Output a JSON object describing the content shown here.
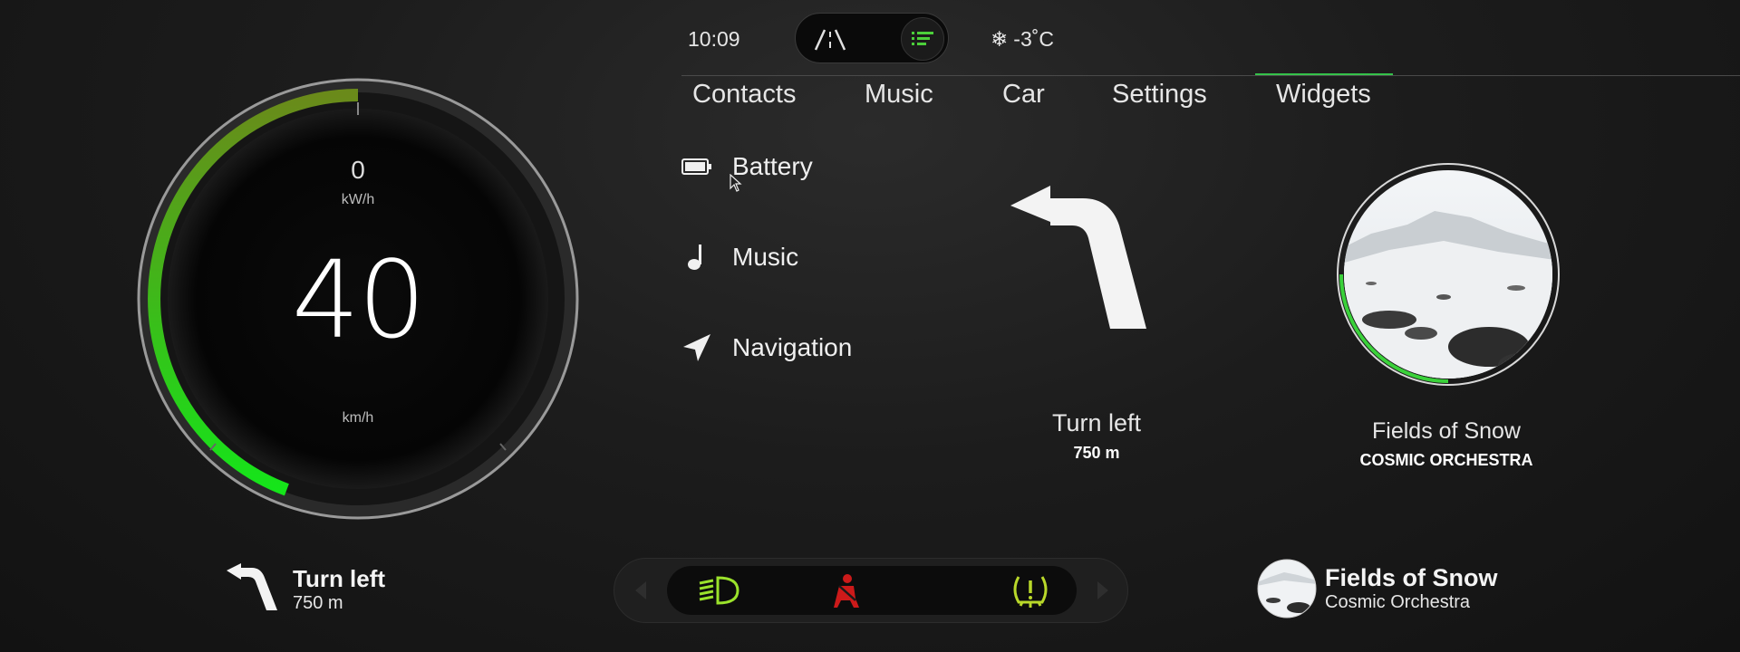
{
  "status": {
    "time": "10:09",
    "temperature": "-3˚C",
    "temp_icon": "snowflake-icon",
    "mode_icons": [
      "road-icon",
      "list-icon"
    ]
  },
  "tabs": [
    {
      "label": "Contacts",
      "active": false
    },
    {
      "label": "Music",
      "active": false
    },
    {
      "label": "Car",
      "active": false
    },
    {
      "label": "Settings",
      "active": false
    },
    {
      "label": "Widgets",
      "active": true
    }
  ],
  "gauge": {
    "power_value": "0",
    "power_unit": "kW/h",
    "speed_value": "40",
    "speed_unit": "km/h",
    "progress_fraction": 0.4,
    "accent_start": "#6b8a1e",
    "accent_end": "#1ee21e"
  },
  "widgets": [
    {
      "label": "Battery",
      "icon": "battery-icon"
    },
    {
      "label": "Music",
      "icon": "music-note-icon"
    },
    {
      "label": "Navigation",
      "icon": "navigation-arrow-icon"
    }
  ],
  "navigation": {
    "instruction": "Turn left",
    "distance": "750 m"
  },
  "music": {
    "title": "Fields of Snow",
    "artist_upper": "COSMIC ORCHESTRA",
    "artist": "Cosmic Orchestra",
    "progress_fraction": 0.25
  },
  "telltales": [
    {
      "icon": "low-beam-headlight-icon",
      "color": "#9be22b"
    },
    {
      "icon": "seatbelt-warning-icon",
      "color": "#cc1a1a"
    },
    {
      "icon": "tire-pressure-warning-icon",
      "color": "#b9d82a"
    }
  ],
  "colors": {
    "accent_green": "#35c24a",
    "background": "#1c1c1c"
  }
}
